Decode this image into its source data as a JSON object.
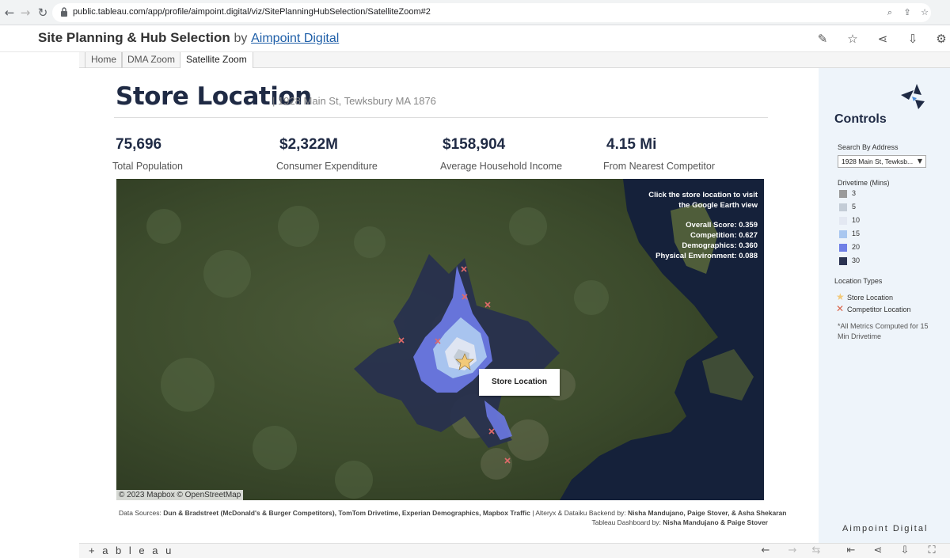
{
  "browser": {
    "url": "public.tableau.com/app/profile/aimpoint.digital/viz/SitePlanningHubSelection/SatelliteZoom#2",
    "back_icon": "←",
    "forward_icon": "→",
    "reload_icon": "↻"
  },
  "header": {
    "title": "Site Planning & Hub Selection",
    "by": "by",
    "author": "Aimpoint Digital"
  },
  "tabs": [
    {
      "label": "Home"
    },
    {
      "label": "DMA Zoom"
    },
    {
      "label": "Satellite Zoom"
    }
  ],
  "store": {
    "title": "Store Location",
    "address": "| 1928 Main St, Tewksbury MA 1876"
  },
  "kpis": [
    {
      "value": "75,696",
      "label": "Total Population"
    },
    {
      "value": "$2,322M",
      "label": "Consumer Expenditure"
    },
    {
      "value": "$158,904",
      "label": "Average Household Income"
    },
    {
      "value": "4.15 Mi",
      "label": "From Nearest Competitor"
    }
  ],
  "map": {
    "hint_line1": "Click the store location to visit",
    "hint_line2": "the Google Earth view",
    "overall": "Overall Score: 0.359",
    "competition": "Competition: 0.627",
    "demographics": "Demographics: 0.360",
    "physical": "Physical Environment: 0.088",
    "tooltip": "Store Location",
    "attribution": "© 2023 Mapbox  © OpenStreetMap"
  },
  "footer": {
    "prefix": "Data Sources: ",
    "sources": "Dun & Bradstreet (McDonald's & Burger Competitors), TomTom Drivetime, Experian Demographics, Mapbox Traffic",
    "backend_prefix": " | Alteryx & Dataiku Backend by: ",
    "backend": "Nisha Mandujano, Paige Stover, & Asha Shekaran",
    "dash_prefix": "Tableau Dashboard by: ",
    "dash": "Nisha Mandujano & Paige Stover"
  },
  "controls": {
    "title": "Controls",
    "search_label": "Search By Address",
    "search_value": "1928 Main St, Tewksb...",
    "drivetime_label": "Drivetime (Mins)",
    "drivetime": [
      {
        "label": "3",
        "color": "#9a9a9a"
      },
      {
        "label": "5",
        "color": "#c3ccd6"
      },
      {
        "label": "10",
        "color": "#e3e8f2"
      },
      {
        "label": "15",
        "color": "#a9c7f0"
      },
      {
        "label": "20",
        "color": "#6f7fe6"
      },
      {
        "label": "30",
        "color": "#2b3352"
      }
    ],
    "location_types_label": "Location Types",
    "store_location": "Store Location",
    "competitor_location": "Competitor Location",
    "note": "*All Metrics Computed for 15 Min Drivetime",
    "brand": "Aimpoint Digital"
  },
  "toolbar": {
    "tableau_logo": "+ a b l e a u"
  }
}
